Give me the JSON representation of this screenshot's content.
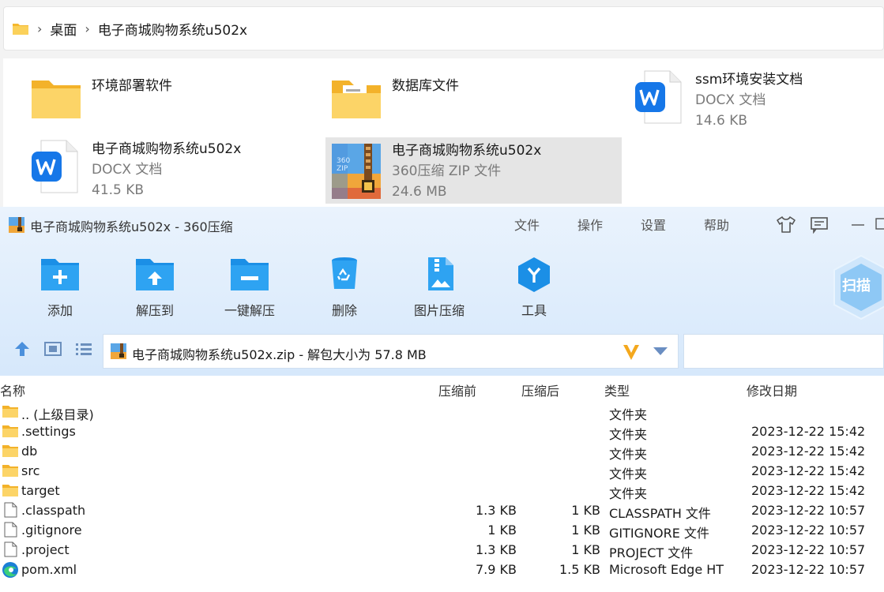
{
  "explorer": {
    "breadcrumb": [
      "桌面",
      "电子商城购物系统u502x"
    ],
    "tiles": [
      {
        "name": "环境部署软件",
        "sub1": "",
        "sub2": ""
      },
      {
        "name": "数据库文件",
        "sub1": "",
        "sub2": ""
      },
      {
        "name": "ssm环境安装文档",
        "sub1": "DOCX 文档",
        "sub2": "14.6 KB"
      },
      {
        "name": "电子商城购物系统u502x",
        "sub1": "DOCX 文档",
        "sub2": "41.5 KB"
      },
      {
        "name": "电子商城购物系统u502x",
        "sub1": "360压缩 ZIP 文件",
        "sub2": "24.6 MB"
      }
    ],
    "zip_icon_text": "360\nZIP"
  },
  "zip": {
    "title": "电子商城购物系统u502x - 360压缩",
    "menu": [
      "文件",
      "操作",
      "设置",
      "帮助"
    ],
    "toolbar": [
      "添加",
      "解压到",
      "一键解压",
      "删除",
      "图片压缩",
      "工具"
    ],
    "scan_label": "扫描",
    "path_text": "电子商城购物系统u502x.zip - 解包大小为 57.8 MB",
    "search_value": "",
    "columns": [
      "名称",
      "压缩前",
      "压缩后",
      "类型",
      "修改日期"
    ],
    "rows": [
      {
        "icon": "folder-icon",
        "name": ".. (上级目录)",
        "before": "",
        "after": "",
        "type": "文件夹",
        "date": ""
      },
      {
        "icon": "folder-icon",
        "name": ".settings",
        "before": "",
        "after": "",
        "type": "文件夹",
        "date": "2023-12-22 15:42"
      },
      {
        "icon": "folder-icon",
        "name": "db",
        "before": "",
        "after": "",
        "type": "文件夹",
        "date": "2023-12-22 15:42"
      },
      {
        "icon": "folder-icon",
        "name": "src",
        "before": "",
        "after": "",
        "type": "文件夹",
        "date": "2023-12-22 15:42"
      },
      {
        "icon": "folder-icon",
        "name": "target",
        "before": "",
        "after": "",
        "type": "文件夹",
        "date": "2023-12-22 15:42"
      },
      {
        "icon": "file-icon",
        "name": ".classpath",
        "before": "1.3 KB",
        "after": "1 KB",
        "type": "CLASSPATH 文件",
        "date": "2023-12-22 10:57"
      },
      {
        "icon": "file-icon",
        "name": ".gitignore",
        "before": "1 KB",
        "after": "1 KB",
        "type": "GITIGNORE 文件",
        "date": "2023-12-22 10:57"
      },
      {
        "icon": "file-icon",
        "name": ".project",
        "before": "1.3 KB",
        "after": "1 KB",
        "type": "PROJECT 文件",
        "date": "2023-12-22 10:57"
      },
      {
        "icon": "edge-icon",
        "name": "pom.xml",
        "before": "7.9 KB",
        "after": "1.5 KB",
        "type": "Microsoft Edge HT",
        "date": "2023-12-22 10:57"
      }
    ]
  },
  "colors": {
    "accent": "#1e88e5",
    "folder": "#f8c64a",
    "toolbar_bg": "#d6e8fb"
  }
}
